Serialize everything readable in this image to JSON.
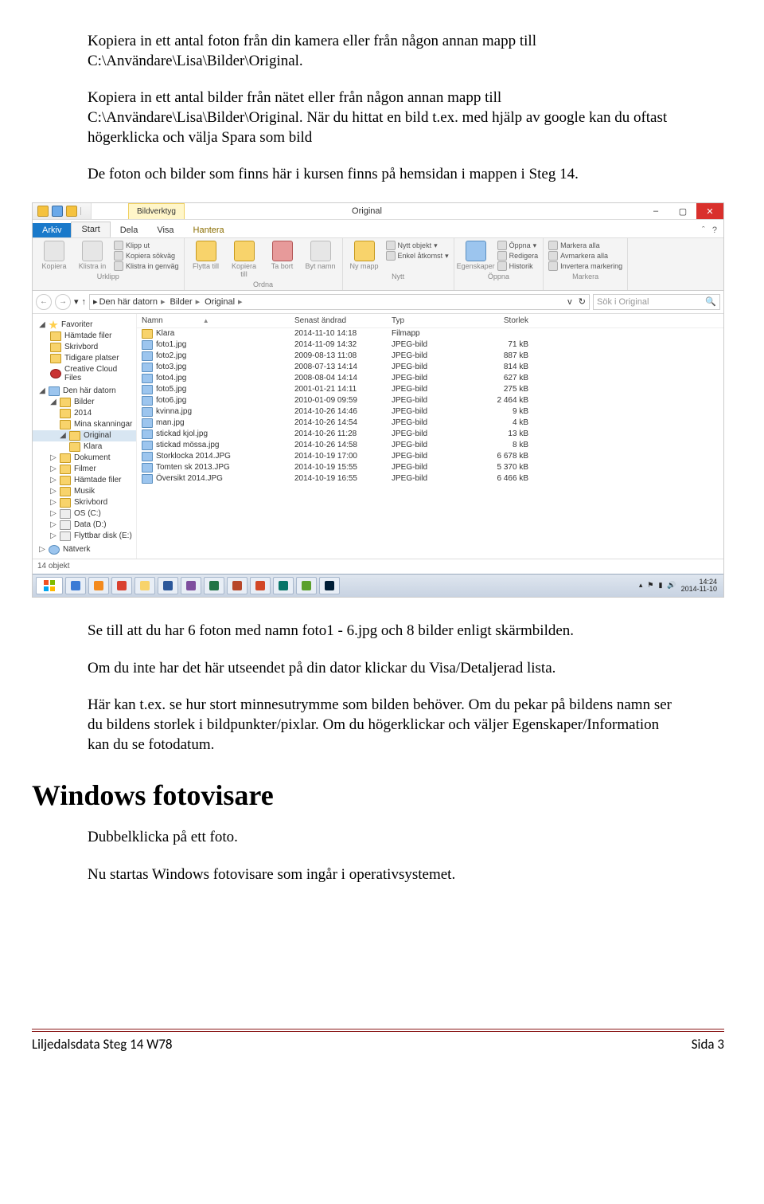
{
  "doc": {
    "para1": "Kopiera in ett antal foton från din kamera eller från någon annan mapp till C:\\Användare\\Lisa\\Bilder\\Original.",
    "para2": "Kopiera in ett antal bilder från nätet eller från någon annan mapp till C:\\Användare\\Lisa\\Bilder\\Original. När du hittat en bild t.ex. med hjälp av google kan du oftast högerklicka och välja Spara som bild",
    "para3": "De foton och bilder som finns här i kursen finns på hemsidan i mappen i Steg 14.",
    "para4": "Se till att du har 6 foton med namn foto1 - 6.jpg och 8 bilder enligt skärmbilden.",
    "para5": "Om du inte har det här utseendet på din dator klickar du Visa/Detaljerad lista.",
    "para6": "Här kan t.ex. se hur stort minnesutrymme som bilden behöver. Om du pekar på bildens namn ser du bildens storlek i bildpunkter/pixlar. Om du högerklickar och väljer Egenskaper/Information kan du se fotodatum.",
    "h1": "Windows fotovisare",
    "para7": "Dubbelklicka på ett foto.",
    "para8": "Nu startas Windows fotovisare som ingår i operativsystemet."
  },
  "explorer": {
    "context_tab": "Bildverktyg",
    "window_title": "Original",
    "tabs": {
      "file": "Arkiv",
      "start": "Start",
      "share": "Dela",
      "view": "Visa",
      "manage": "Hantera"
    },
    "ribbon": {
      "clipboard": {
        "copy": "Kopiera",
        "paste": "Klistra in",
        "cut": "Klipp ut",
        "copy_path": "Kopiera sökväg",
        "paste_shortcut": "Klistra in genväg",
        "group": "Urklipp"
      },
      "organize": {
        "moveto": "Flytta till",
        "copyto": "Kopiera till",
        "delete": "Ta bort",
        "rename": "Byt namn",
        "group": "Ordna"
      },
      "new": {
        "newfolder": "Ny mapp",
        "newitem": "Nytt objekt",
        "easy": "Enkel åtkomst",
        "group": "Nytt"
      },
      "open": {
        "props": "Egenskaper",
        "open": "Öppna",
        "edit": "Redigera",
        "history": "Historik",
        "group": "Öppna"
      },
      "select": {
        "all": "Markera alla",
        "none": "Avmarkera alla",
        "invert": "Invertera markering",
        "group": "Markera"
      }
    },
    "breadcrumb": [
      "Den här datorn",
      "Bilder",
      "Original"
    ],
    "search_placeholder": "Sök i Original",
    "columns": {
      "name": "Namn",
      "date": "Senast ändrad",
      "type": "Typ",
      "size": "Storlek"
    },
    "nav": {
      "favorites": "Favoriter",
      "downloads": "Hämtade filer",
      "desktop": "Skrivbord",
      "recent": "Tidigare platser",
      "cloud": "Creative Cloud Files",
      "thispc": "Den här datorn",
      "pictures": "Bilder",
      "year": "2014",
      "scans": "Mina skanningar",
      "original": "Original",
      "klara_nav": "Klara",
      "documents": "Dokument",
      "movies": "Filmer",
      "dl2": "Hämtade filer",
      "music": "Musik",
      "desk2": "Skrivbord",
      "osc": "OS (C:)",
      "datad": "Data (D:)",
      "reme": "Flyttbar disk (E:)",
      "network": "Nätverk"
    },
    "files": [
      {
        "name": "Klara",
        "date": "2014-11-10 14:18",
        "type": "Filmapp",
        "size": "",
        "icon": "folder"
      },
      {
        "name": "foto1.jpg",
        "date": "2014-11-09 14:32",
        "type": "JPEG-bild",
        "size": "71 kB",
        "icon": "img"
      },
      {
        "name": "foto2.jpg",
        "date": "2009-08-13 11:08",
        "type": "JPEG-bild",
        "size": "887 kB",
        "icon": "img"
      },
      {
        "name": "foto3.jpg",
        "date": "2008-07-13 14:14",
        "type": "JPEG-bild",
        "size": "814 kB",
        "icon": "img"
      },
      {
        "name": "foto4.jpg",
        "date": "2008-08-04 14:14",
        "type": "JPEG-bild",
        "size": "627 kB",
        "icon": "img"
      },
      {
        "name": "foto5.jpg",
        "date": "2001-01-21 14:11",
        "type": "JPEG-bild",
        "size": "275 kB",
        "icon": "img"
      },
      {
        "name": "foto6.jpg",
        "date": "2010-01-09 09:59",
        "type": "JPEG-bild",
        "size": "2 464 kB",
        "icon": "img"
      },
      {
        "name": "kvinna.jpg",
        "date": "2014-10-26 14:46",
        "type": "JPEG-bild",
        "size": "9 kB",
        "icon": "img"
      },
      {
        "name": "man.jpg",
        "date": "2014-10-26 14:54",
        "type": "JPEG-bild",
        "size": "4 kB",
        "icon": "img"
      },
      {
        "name": "stickad kjol.jpg",
        "date": "2014-10-26 11:28",
        "type": "JPEG-bild",
        "size": "13 kB",
        "icon": "img"
      },
      {
        "name": "stickad mössa.jpg",
        "date": "2014-10-26 14:58",
        "type": "JPEG-bild",
        "size": "8 kB",
        "icon": "img"
      },
      {
        "name": "Storklocka 2014.JPG",
        "date": "2014-10-19 17:00",
        "type": "JPEG-bild",
        "size": "6 678 kB",
        "icon": "img"
      },
      {
        "name": "Tomten sk 2013.JPG",
        "date": "2014-10-19 15:55",
        "type": "JPEG-bild",
        "size": "5 370 kB",
        "icon": "img"
      },
      {
        "name": "Översikt 2014.JPG",
        "date": "2014-10-19 16:55",
        "type": "JPEG-bild",
        "size": "6 466 kB",
        "icon": "img"
      }
    ],
    "status": "14 objekt",
    "clock": {
      "time": "14:24",
      "date": "2014-11-10"
    }
  },
  "footer": {
    "left": "Liljedalsdata Steg 14 W78",
    "right": "Sida 3"
  }
}
